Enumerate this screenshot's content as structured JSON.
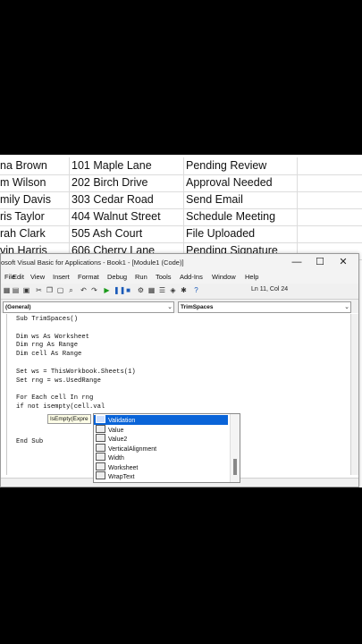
{
  "sheet": {
    "rows": [
      {
        "name": "na Brown",
        "address": "101 Maple Lane",
        "status": "Pending Review"
      },
      {
        "name": "m Wilson",
        "address": "202 Birch Drive",
        "status": "Approval Needed"
      },
      {
        "name": "mily Davis",
        "address": "303 Cedar Road",
        "status": "Send Email"
      },
      {
        "name": "ris Taylor",
        "address": "404 Walnut Street",
        "status": "Schedule Meeting"
      },
      {
        "name": "rah Clark",
        "address": "505 Ash Court",
        "status": "File Uploaded"
      },
      {
        "name": "vin Harris",
        "address": "606 Cherry Lane",
        "status": "Pending Signature"
      }
    ]
  },
  "vba": {
    "title": "osoft Visual Basic for Applications - Book1 - [Module1 (Code)]",
    "window_buttons": {
      "minimize": "—",
      "maximize": "☐",
      "close": "✕"
    },
    "menu": [
      "File",
      "Edit",
      "View",
      "Insert",
      "Format",
      "Debug",
      "Run",
      "Tools",
      "Add-Ins",
      "Window",
      "Help"
    ],
    "status_position": "Ln 11, Col 24",
    "object_combo": "(General)",
    "proc_combo": "TrimSpaces",
    "code_lines": [
      "Sub TrimSpaces()",
      "",
      "Dim ws As Worksheet",
      "Dim rng As Range",
      "Dim cell As Range",
      "",
      "Set ws = ThisWorkbook.Sheets(1)",
      "Set rng = ws.UsedRange",
      "",
      "For Each cell In rng",
      "if not isempty(cell.val",
      "",
      "",
      "",
      "End Sub"
    ],
    "tooltip": "IsEmpty(Expre",
    "autocomplete": {
      "items": [
        "Validation",
        "Value",
        "Value2",
        "VerticalAlignment",
        "Width",
        "Worksheet",
        "WrapText"
      ],
      "selected": "Validation"
    }
  }
}
